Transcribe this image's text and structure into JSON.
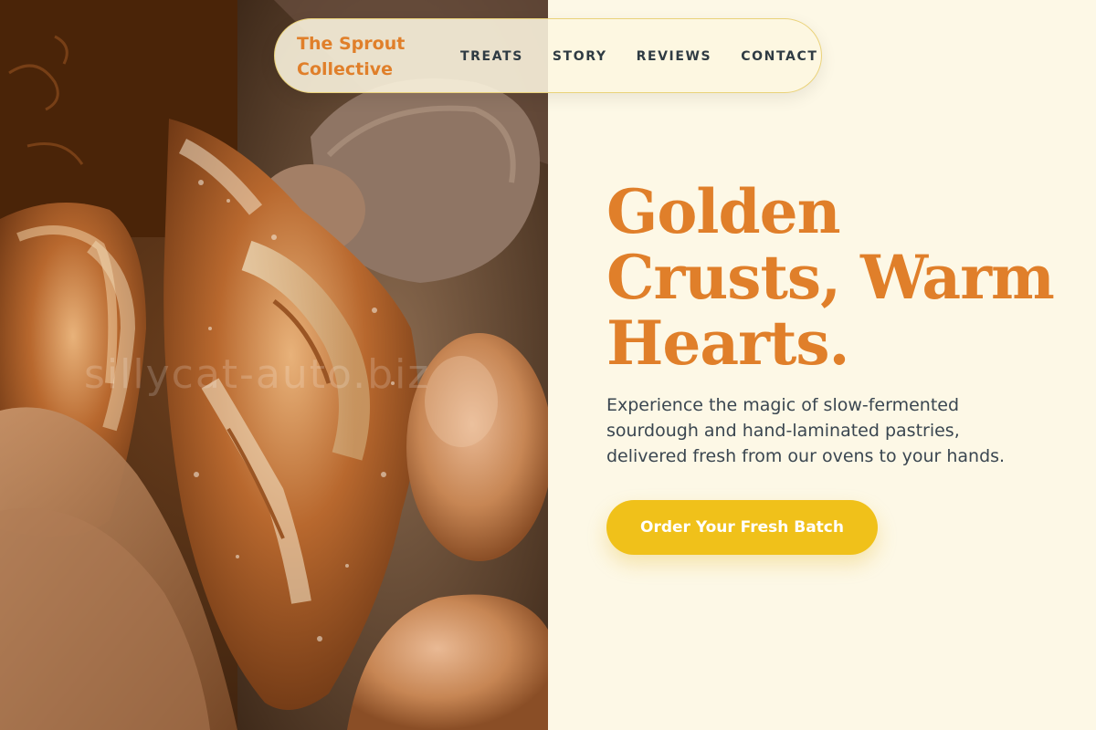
{
  "brand": {
    "name": "The Sprout Collective"
  },
  "nav": {
    "links": [
      "TREATS",
      "STORY",
      "REVIEWS",
      "CONTACT"
    ]
  },
  "hero": {
    "title": "Golden Crusts, Warm Hearts.",
    "description": "Experience the magic of slow-fermented sourdough and hand-laminated pastries, delivered fresh from our ovens to your hands.",
    "cta_label": "Order Your Fresh Batch"
  },
  "watermark": "sillycat-auto.biz",
  "colors": {
    "accent": "#e07f2a",
    "cta": "#f0c11a",
    "background": "#fdf8e6",
    "nav_text": "#2f3b43",
    "body_text": "#3a4650"
  }
}
